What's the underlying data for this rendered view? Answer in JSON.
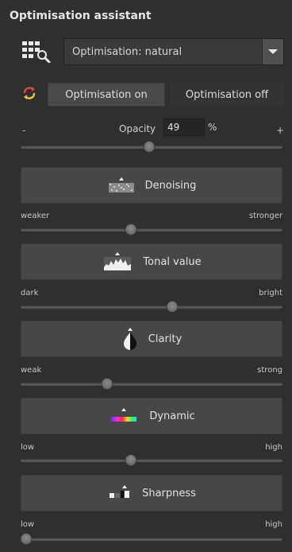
{
  "panel": {
    "title": "Optimisation assistant",
    "preset": {
      "value": "Optimisation: natural",
      "icon": "grid-magnifier-icon"
    },
    "toggle": {
      "icon": "refresh-icon",
      "on_label": "Optimisation on",
      "off_label": "Optimisation off",
      "active": "on"
    },
    "opacity": {
      "minus": "-",
      "label": "Opacity",
      "value": "49",
      "unit": "%",
      "plus": "+",
      "level": 0.49
    },
    "tools": [
      {
        "name": "Denoising",
        "left_label": "weaker",
        "right_label": "stronger",
        "level": 0.42,
        "icon": "noise-icon"
      },
      {
        "name": "Tonal value",
        "left_label": "dark",
        "right_label": "bright",
        "level": 0.58,
        "icon": "histogram-icon"
      },
      {
        "name": "Clarity",
        "left_label": "weak",
        "right_label": "strong",
        "level": 0.33,
        "icon": "contrast-drop-icon"
      },
      {
        "name": "Dynamic",
        "left_label": "low",
        "right_label": "high",
        "level": 0.42,
        "icon": "color-spectrum-icon"
      },
      {
        "name": "Sharpness",
        "left_label": "low",
        "right_label": "high",
        "level": 0.02,
        "icon": "sharpness-icon"
      }
    ]
  },
  "colors": {
    "background": "#2f2f2f",
    "button": "#474747",
    "track": "#555555",
    "accent_refresh_red": "#e04a3a",
    "accent_refresh_yellow": "#f0c23a"
  }
}
